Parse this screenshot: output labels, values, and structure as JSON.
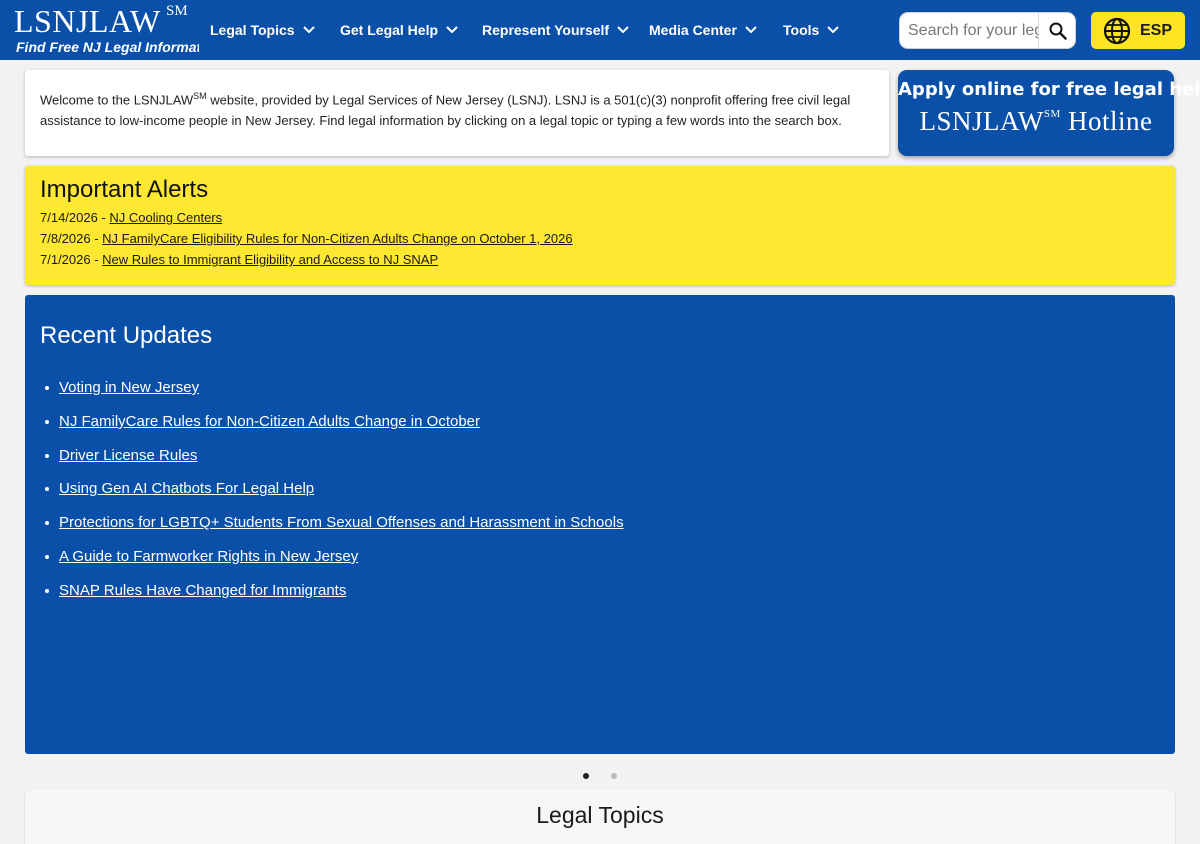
{
  "header": {
    "logo_name": "LSNJLAW",
    "logo_sm": "SM",
    "logo_tagline": "Find Free NJ Legal Information",
    "nav": [
      {
        "label": "Legal Topics"
      },
      {
        "label": "Get Legal Help"
      },
      {
        "label": "Represent Yourself"
      },
      {
        "label": "Media Center"
      },
      {
        "label": "Tools"
      }
    ],
    "search": {
      "placeholder": "Search for your legal issue",
      "value": ""
    },
    "language_button": "ESP",
    "colors": {
      "brand_blue": "#0a50a8",
      "accent_yellow": "#ffe422"
    }
  },
  "welcome": {
    "text_before": "Welcome to the LSNJLAW",
    "sup": "SM",
    "text_after": " website, provided by Legal Services of New Jersey (LSNJ). LSNJ is a 501(c)(3) nonprofit offering free civil legal assistance to low-income people in New Jersey. Find legal information by clicking on a legal topic or typing a few words into the search box."
  },
  "hotline": {
    "line1": "Apply online for free legal help",
    "name": "LSNJLAW",
    "sup": "SM",
    "suffix": "Hotline"
  },
  "alerts": {
    "title": "Important Alerts",
    "items": [
      {
        "date": "7/14/2026",
        "title": "NJ Cooling Centers"
      },
      {
        "date": "7/8/2026",
        "title": "NJ FamilyCare Eligibility Rules for Non-Citizen Adults Change on October 1, 2026"
      },
      {
        "date": "7/1/2026",
        "title": "New Rules to Immigrant Eligibility and Access to NJ SNAP"
      }
    ]
  },
  "updates": {
    "title": "Recent Updates",
    "items": [
      "Voting in New Jersey",
      "NJ FamilyCare Rules for Non-Citizen Adults Change in October",
      "Driver License Rules",
      "Using Gen AI Chatbots For Legal Help",
      "Protections for LGBTQ+ Students From Sexual Offenses and Harassment in Schools",
      "A Guide to Farmworker Rights in New Jersey",
      "SNAP Rules Have Changed for Immigrants"
    ]
  },
  "carousel": {
    "total_slides": 2,
    "active_slide": 1,
    "active_color": "#222222",
    "inactive_color": "#bbbbbb"
  },
  "legal_topics": {
    "title": "Legal Topics"
  }
}
